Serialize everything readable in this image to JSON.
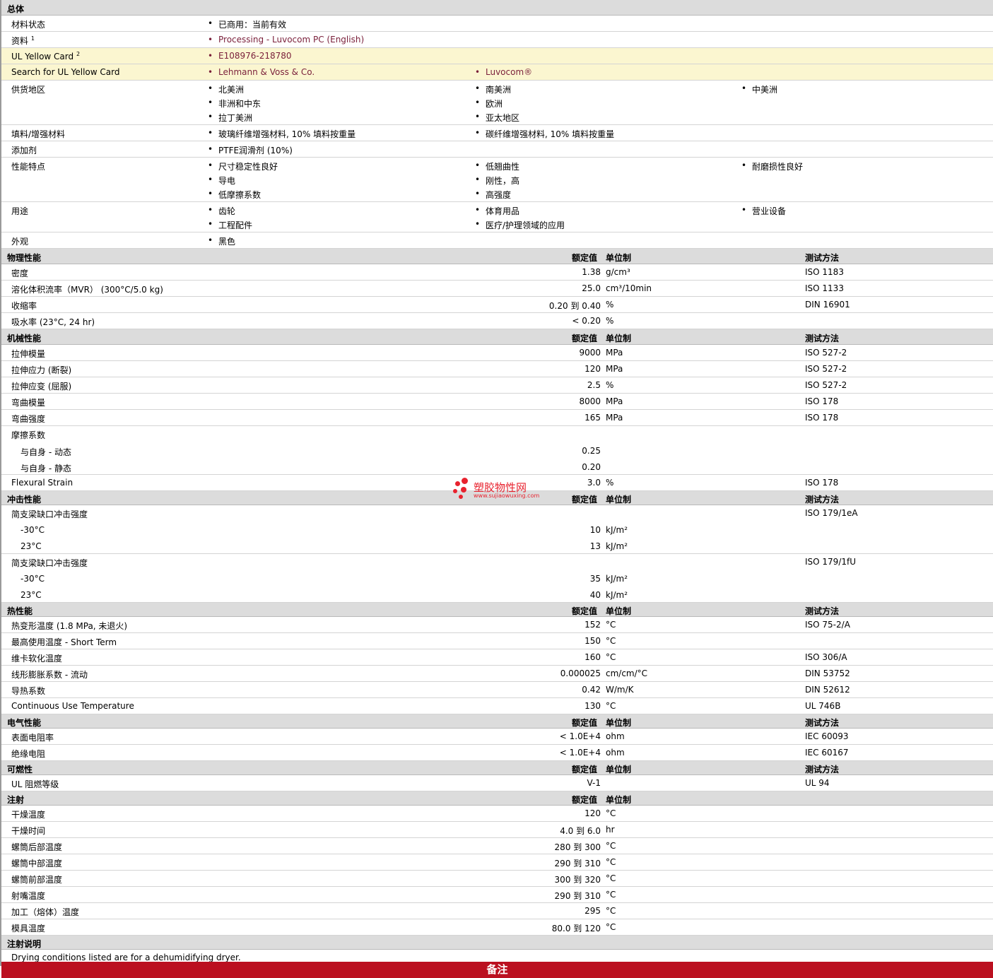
{
  "general": {
    "title": "总体",
    "material_status_label": "材料状态",
    "material_status": "已商用：当前有效",
    "docs_label": "资料",
    "docs_sup": "1",
    "docs_link": "Processing - Luvocom PC (English)",
    "ul_card_label": "UL Yellow Card",
    "ul_card_sup": "2",
    "ul_card_value": "E108976-218780",
    "ul_search_label": "Search for UL Yellow Card",
    "ul_search_1": "Lehmann & Voss & Co.",
    "ul_search_2": "Luvocom®",
    "supply_label": "供货地区",
    "supply": [
      "北美洲",
      "南美洲",
      "中美洲",
      "非洲和中东",
      "欧洲",
      "拉丁美洲",
      "亚太地区"
    ],
    "filler_label": "填料/增强材料",
    "filler": [
      "玻璃纤维增强材料, 10% 填料按重量",
      "碳纤维增强材料, 10% 填料按重量"
    ],
    "additive_label": "添加剂",
    "additive": "PTFE润滑剂 (10%)",
    "features_label": "性能特点",
    "features": [
      "尺寸稳定性良好",
      "低翘曲性",
      "耐磨损性良好",
      "导电",
      "刚性，高",
      "低摩擦系数",
      "高强度"
    ],
    "uses_label": "用途",
    "uses": [
      "齿轮",
      "体育用品",
      "营业设备",
      "工程配件",
      "医疗/护理领域的应用"
    ],
    "appearance_label": "外观",
    "appearance": "黑色"
  },
  "col_headers": {
    "value": "额定值",
    "unit": "单位制",
    "test": "测试方法"
  },
  "physical": {
    "title": "物理性能",
    "rows": [
      {
        "label": "密度",
        "value": "1.38",
        "unit": "g/cm³",
        "test": "ISO 1183"
      },
      {
        "label": "溶化体积流率（MVR） (300°C/5.0 kg)",
        "value": "25.0",
        "unit": "cm³/10min",
        "test": "ISO 1133"
      },
      {
        "label": "收缩率",
        "value": "0.20 到  0.40",
        "unit": "%",
        "test": "DIN 16901"
      },
      {
        "label": "吸水率 (23°C, 24 hr)",
        "value": "< 0.20",
        "unit": "%",
        "test": ""
      }
    ]
  },
  "mechanical": {
    "title": "机械性能",
    "rows": [
      {
        "label": "拉伸模量",
        "value": "9000",
        "unit": "MPa",
        "test": "ISO 527-2"
      },
      {
        "label": "拉伸应力 (断裂)",
        "value": "120",
        "unit": "MPa",
        "test": "ISO 527-2"
      },
      {
        "label": "拉伸应变 (屈服)",
        "value": "2.5",
        "unit": "%",
        "test": "ISO 527-2"
      },
      {
        "label": "弯曲模量",
        "value": "8000",
        "unit": "MPa",
        "test": "ISO 178"
      },
      {
        "label": "弯曲强度",
        "value": "165",
        "unit": "MPa",
        "test": "ISO 178"
      }
    ],
    "friction_label": "摩擦系数",
    "friction_rows": [
      {
        "label": "与自身  - 动态",
        "value": "0.25"
      },
      {
        "label": "与自身  - 静态",
        "value": "0.20"
      }
    ],
    "flex_strain": {
      "label": "Flexural Strain",
      "value": "3.0",
      "unit": "%",
      "test": "ISO 178"
    }
  },
  "impact": {
    "title": "冲击性能",
    "groups": [
      {
        "label": "简支梁缺口冲击强度",
        "test": "ISO 179/1eA",
        "rows": [
          {
            "label": "-30°C",
            "value": "10",
            "unit": "kJ/m²"
          },
          {
            "label": "23°C",
            "value": "13",
            "unit": "kJ/m²"
          }
        ]
      },
      {
        "label": "简支梁缺口冲击强度",
        "test": "ISO 179/1fU",
        "rows": [
          {
            "label": "-30°C",
            "value": "35",
            "unit": "kJ/m²"
          },
          {
            "label": "23°C",
            "value": "40",
            "unit": "kJ/m²"
          }
        ]
      }
    ]
  },
  "thermal": {
    "title": "热性能",
    "rows": [
      {
        "label": "热变形温度 (1.8 MPa, 未退火)",
        "value": "152",
        "unit": "°C",
        "test": "ISO 75-2/A"
      },
      {
        "label": "最高使用温度  - Short Term",
        "value": "150",
        "unit": "°C",
        "test": ""
      },
      {
        "label": "维卡软化温度",
        "value": "160",
        "unit": "°C",
        "test": "ISO 306/A"
      },
      {
        "label": "线形膨胀系数  - 流动",
        "value": "0.000025",
        "unit": "cm/cm/°C",
        "test": "DIN 53752"
      },
      {
        "label": "导热系数",
        "value": "0.42",
        "unit": "W/m/K",
        "test": "DIN 52612"
      },
      {
        "label": "Continuous Use Temperature",
        "value": "130",
        "unit": "°C",
        "test": "UL 746B"
      }
    ]
  },
  "electrical": {
    "title": "电气性能",
    "rows": [
      {
        "label": "表面电阻率",
        "value": "< 1.0E+4",
        "unit": "ohm",
        "test": "IEC 60093"
      },
      {
        "label": "绝缘电阻",
        "value": "< 1.0E+4",
        "unit": "ohm",
        "test": "IEC 60167"
      }
    ]
  },
  "flammability": {
    "title": "可燃性",
    "rows": [
      {
        "label": "UL 阻燃等级",
        "value": "V-1",
        "unit": "",
        "test": "UL 94"
      }
    ]
  },
  "injection": {
    "title": "注射",
    "rows": [
      {
        "label": "干燥温度",
        "value": "120",
        "unit": "°C"
      },
      {
        "label": "干燥时间",
        "value": "4.0 到  6.0",
        "unit": "hr"
      },
      {
        "label": "螺筒后部温度",
        "value": "280 到  300",
        "unit": "°C"
      },
      {
        "label": "螺筒中部温度",
        "value": "290 到  310",
        "unit": "°C"
      },
      {
        "label": "螺筒前部温度",
        "value": "300 到  320",
        "unit": "°C"
      },
      {
        "label": "射嘴温度",
        "value": "290 到  310",
        "unit": "°C"
      },
      {
        "label": "加工（熔体）温度",
        "value": "295",
        "unit": "°C"
      },
      {
        "label": "模具温度",
        "value": "80.0 到  120",
        "unit": "°C"
      }
    ]
  },
  "injection_notes": {
    "title": "注射说明",
    "text": "Drying conditions listed are for a dehumidifying dryer."
  },
  "footer": {
    "label": "备注"
  },
  "watermark": {
    "name": "塑胶物性网",
    "url": "www.sujiaowuxing.com"
  }
}
